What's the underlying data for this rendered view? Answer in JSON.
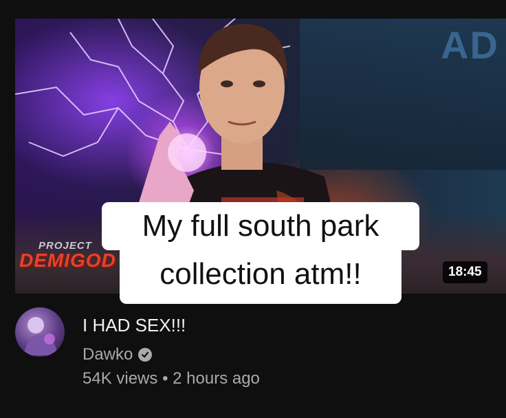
{
  "thumbnail": {
    "corner_text": "AD",
    "logo_top": "PROJECT",
    "logo_main": "DEMIGOD",
    "duration": "18:45"
  },
  "caption": {
    "line1": "My full south park",
    "line2": "collection atm!!"
  },
  "video": {
    "title": "I HAD SEX!!!",
    "channel": "Dawko",
    "views": "54K views",
    "separator": "•",
    "age": "2 hours ago"
  },
  "icons": {
    "verified": "verified-check-icon",
    "avatar": "channel-avatar"
  },
  "colors": {
    "background": "#0f0f0f",
    "title": "#f1f1f1",
    "meta": "#aaaaaa",
    "caption_bg": "#ffffff",
    "logo_red": "#e8412c"
  }
}
